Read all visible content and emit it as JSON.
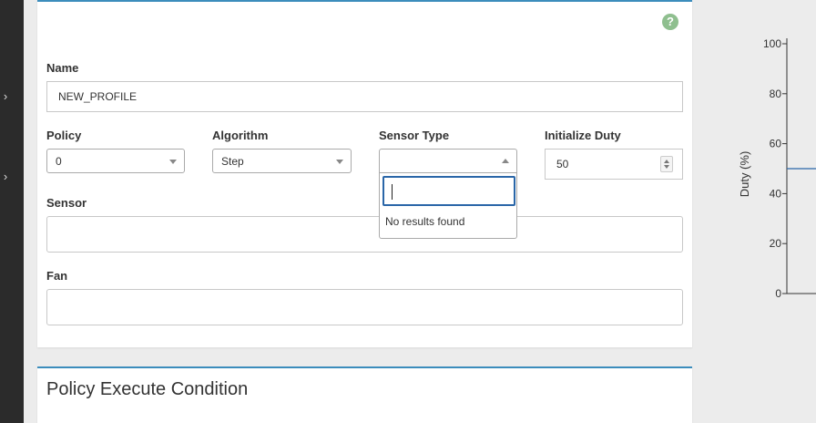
{
  "sidebar": {
    "items": [
      {
        "icon": "chevron-right-icon"
      },
      {
        "icon": "chevron-right-icon"
      }
    ]
  },
  "form": {
    "help_icon": "question-mark",
    "name": {
      "label": "Name",
      "value": "NEW_PROFILE"
    },
    "policy": {
      "label": "Policy",
      "value": "0"
    },
    "algorithm": {
      "label": "Algorithm",
      "value": "Step"
    },
    "sensor_type": {
      "label": "Sensor Type",
      "value": "",
      "search_value": "",
      "no_results_text": "No results found"
    },
    "initialize_duty": {
      "label": "Initialize Duty",
      "value": "50"
    },
    "sensor": {
      "label": "Sensor",
      "value": ""
    },
    "fan": {
      "label": "Fan",
      "value": ""
    }
  },
  "second_card": {
    "title": "Policy Execute Condition"
  },
  "chart_data": {
    "type": "line",
    "ylabel": "Duty (%)",
    "yticks": [
      "100",
      "80",
      "60",
      "40",
      "20",
      "0"
    ],
    "ylim": [
      0,
      100
    ],
    "series": [
      {
        "values": [
          50,
          50
        ]
      }
    ]
  }
}
